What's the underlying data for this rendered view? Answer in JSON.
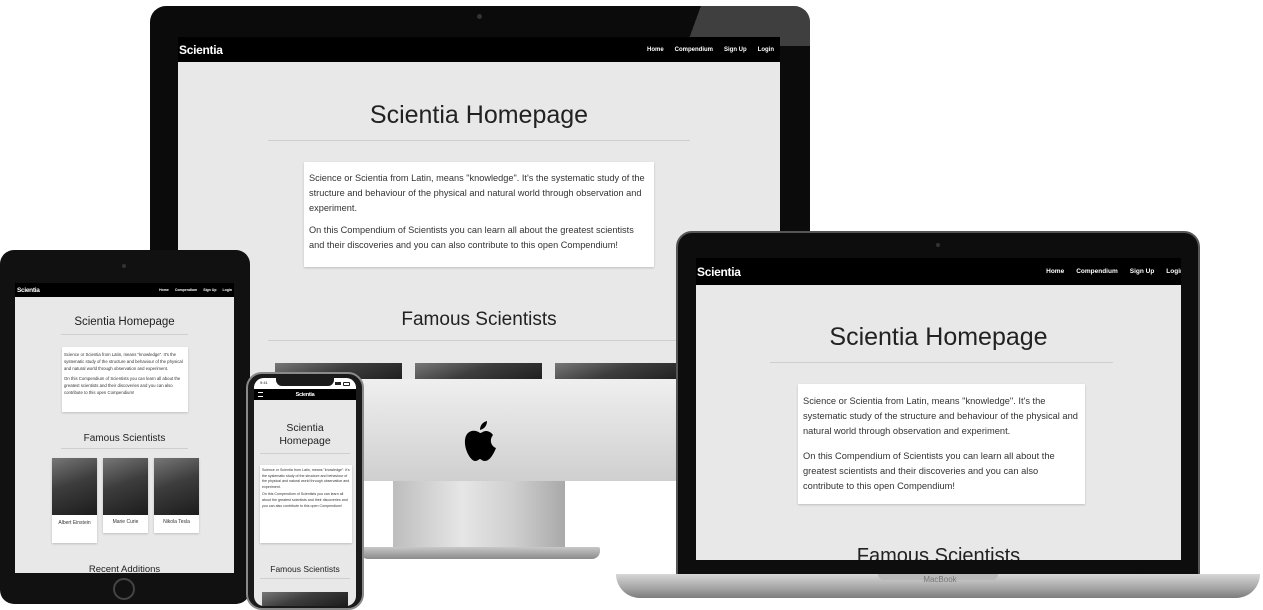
{
  "site": {
    "brand": "Scientia",
    "nav_links": [
      "Home",
      "Compendium",
      "Sign Up",
      "Login"
    ],
    "page_title": "Scientia Homepage",
    "intro_p1": "Science or Scientia from Latin, means \"knowledge\". It's the systematic study of the structure and behaviour of the physical and natural world through observation and experiment.",
    "intro_p2": "On this Compendium of Scientists you can learn all about the greatest scientists and their discoveries and you can also contribute to this open Compendium!",
    "famous_heading": "Famous Scientists",
    "scientists": [
      "Albert Einstein",
      "Marie Curie",
      "Nikola Tesla"
    ],
    "recent_heading": "Recent Additions"
  },
  "phone": {
    "status_time": "9:41",
    "menu_icon": "hamburger-icon"
  },
  "laptop": {
    "brand_label": "MacBook"
  },
  "colors": {
    "navbar": "#000000",
    "page_background": "#e8e8e8",
    "card_background": "#ffffff"
  }
}
